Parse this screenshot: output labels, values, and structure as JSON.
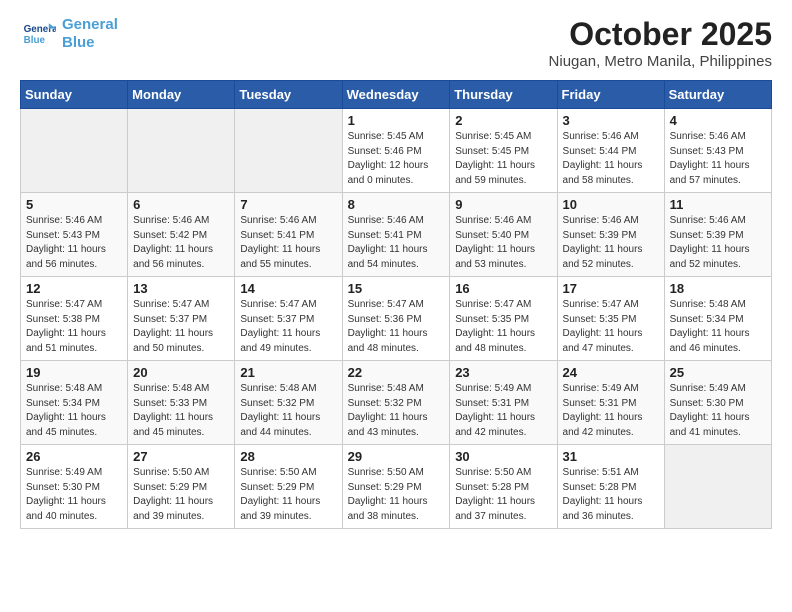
{
  "header": {
    "logo_line1": "General",
    "logo_line2": "Blue",
    "month": "October 2025",
    "location": "Niugan, Metro Manila, Philippines"
  },
  "weekdays": [
    "Sunday",
    "Monday",
    "Tuesday",
    "Wednesday",
    "Thursday",
    "Friday",
    "Saturday"
  ],
  "weeks": [
    [
      {
        "num": "",
        "info": ""
      },
      {
        "num": "",
        "info": ""
      },
      {
        "num": "",
        "info": ""
      },
      {
        "num": "1",
        "info": "Sunrise: 5:45 AM\nSunset: 5:46 PM\nDaylight: 12 hours\nand 0 minutes."
      },
      {
        "num": "2",
        "info": "Sunrise: 5:45 AM\nSunset: 5:45 PM\nDaylight: 11 hours\nand 59 minutes."
      },
      {
        "num": "3",
        "info": "Sunrise: 5:46 AM\nSunset: 5:44 PM\nDaylight: 11 hours\nand 58 minutes."
      },
      {
        "num": "4",
        "info": "Sunrise: 5:46 AM\nSunset: 5:43 PM\nDaylight: 11 hours\nand 57 minutes."
      }
    ],
    [
      {
        "num": "5",
        "info": "Sunrise: 5:46 AM\nSunset: 5:43 PM\nDaylight: 11 hours\nand 56 minutes."
      },
      {
        "num": "6",
        "info": "Sunrise: 5:46 AM\nSunset: 5:42 PM\nDaylight: 11 hours\nand 56 minutes."
      },
      {
        "num": "7",
        "info": "Sunrise: 5:46 AM\nSunset: 5:41 PM\nDaylight: 11 hours\nand 55 minutes."
      },
      {
        "num": "8",
        "info": "Sunrise: 5:46 AM\nSunset: 5:41 PM\nDaylight: 11 hours\nand 54 minutes."
      },
      {
        "num": "9",
        "info": "Sunrise: 5:46 AM\nSunset: 5:40 PM\nDaylight: 11 hours\nand 53 minutes."
      },
      {
        "num": "10",
        "info": "Sunrise: 5:46 AM\nSunset: 5:39 PM\nDaylight: 11 hours\nand 52 minutes."
      },
      {
        "num": "11",
        "info": "Sunrise: 5:46 AM\nSunset: 5:39 PM\nDaylight: 11 hours\nand 52 minutes."
      }
    ],
    [
      {
        "num": "12",
        "info": "Sunrise: 5:47 AM\nSunset: 5:38 PM\nDaylight: 11 hours\nand 51 minutes."
      },
      {
        "num": "13",
        "info": "Sunrise: 5:47 AM\nSunset: 5:37 PM\nDaylight: 11 hours\nand 50 minutes."
      },
      {
        "num": "14",
        "info": "Sunrise: 5:47 AM\nSunset: 5:37 PM\nDaylight: 11 hours\nand 49 minutes."
      },
      {
        "num": "15",
        "info": "Sunrise: 5:47 AM\nSunset: 5:36 PM\nDaylight: 11 hours\nand 48 minutes."
      },
      {
        "num": "16",
        "info": "Sunrise: 5:47 AM\nSunset: 5:35 PM\nDaylight: 11 hours\nand 48 minutes."
      },
      {
        "num": "17",
        "info": "Sunrise: 5:47 AM\nSunset: 5:35 PM\nDaylight: 11 hours\nand 47 minutes."
      },
      {
        "num": "18",
        "info": "Sunrise: 5:48 AM\nSunset: 5:34 PM\nDaylight: 11 hours\nand 46 minutes."
      }
    ],
    [
      {
        "num": "19",
        "info": "Sunrise: 5:48 AM\nSunset: 5:34 PM\nDaylight: 11 hours\nand 45 minutes."
      },
      {
        "num": "20",
        "info": "Sunrise: 5:48 AM\nSunset: 5:33 PM\nDaylight: 11 hours\nand 45 minutes."
      },
      {
        "num": "21",
        "info": "Sunrise: 5:48 AM\nSunset: 5:32 PM\nDaylight: 11 hours\nand 44 minutes."
      },
      {
        "num": "22",
        "info": "Sunrise: 5:48 AM\nSunset: 5:32 PM\nDaylight: 11 hours\nand 43 minutes."
      },
      {
        "num": "23",
        "info": "Sunrise: 5:49 AM\nSunset: 5:31 PM\nDaylight: 11 hours\nand 42 minutes."
      },
      {
        "num": "24",
        "info": "Sunrise: 5:49 AM\nSunset: 5:31 PM\nDaylight: 11 hours\nand 42 minutes."
      },
      {
        "num": "25",
        "info": "Sunrise: 5:49 AM\nSunset: 5:30 PM\nDaylight: 11 hours\nand 41 minutes."
      }
    ],
    [
      {
        "num": "26",
        "info": "Sunrise: 5:49 AM\nSunset: 5:30 PM\nDaylight: 11 hours\nand 40 minutes."
      },
      {
        "num": "27",
        "info": "Sunrise: 5:50 AM\nSunset: 5:29 PM\nDaylight: 11 hours\nand 39 minutes."
      },
      {
        "num": "28",
        "info": "Sunrise: 5:50 AM\nSunset: 5:29 PM\nDaylight: 11 hours\nand 39 minutes."
      },
      {
        "num": "29",
        "info": "Sunrise: 5:50 AM\nSunset: 5:29 PM\nDaylight: 11 hours\nand 38 minutes."
      },
      {
        "num": "30",
        "info": "Sunrise: 5:50 AM\nSunset: 5:28 PM\nDaylight: 11 hours\nand 37 minutes."
      },
      {
        "num": "31",
        "info": "Sunrise: 5:51 AM\nSunset: 5:28 PM\nDaylight: 11 hours\nand 36 minutes."
      },
      {
        "num": "",
        "info": ""
      }
    ]
  ]
}
